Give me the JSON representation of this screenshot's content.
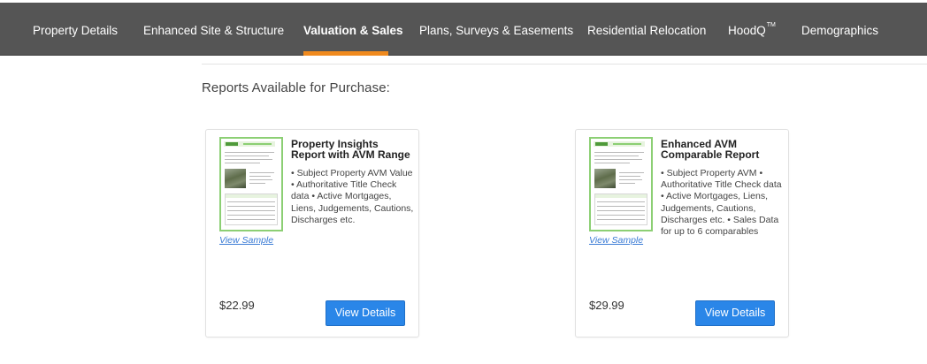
{
  "nav": {
    "items": [
      {
        "label": "Property Details"
      },
      {
        "label": "Enhanced Site & Structure"
      },
      {
        "label": "Valuation & Sales",
        "active": true
      },
      {
        "label": "Plans, Surveys & Easements"
      },
      {
        "label": "Residential Relocation"
      },
      {
        "label": "HoodQ",
        "superscript": "TM"
      },
      {
        "label": "Demographics"
      }
    ]
  },
  "section": {
    "title": "Reports Available for Purchase:"
  },
  "reports": [
    {
      "title": "Property Insights Report with AVM Range",
      "description": "• Subject Property AVM Value • Authoritative Title Check data • Active Mortgages, Liens, Judgements, Cautions, Discharges etc.",
      "sample_link": "View Sample",
      "price": "$22.99",
      "button": "View Details"
    },
    {
      "title": "Enhanced AVM Comparable Report",
      "description": "• Subject Property AVM • Authoritative Title Check data • Active Mortgages, Liens, Judgements, Cautions, Discharges etc. • Sales Data for up to 6 comparables",
      "sample_link": "View Sample",
      "price": "$29.99",
      "button": "View Details"
    }
  ],
  "colors": {
    "nav_bg": "#555555",
    "nav_active_underline": "#f08a1e",
    "button_bg": "#2a86e8",
    "link": "#3a7bd5",
    "thumbnail_border": "#8ccf74"
  }
}
